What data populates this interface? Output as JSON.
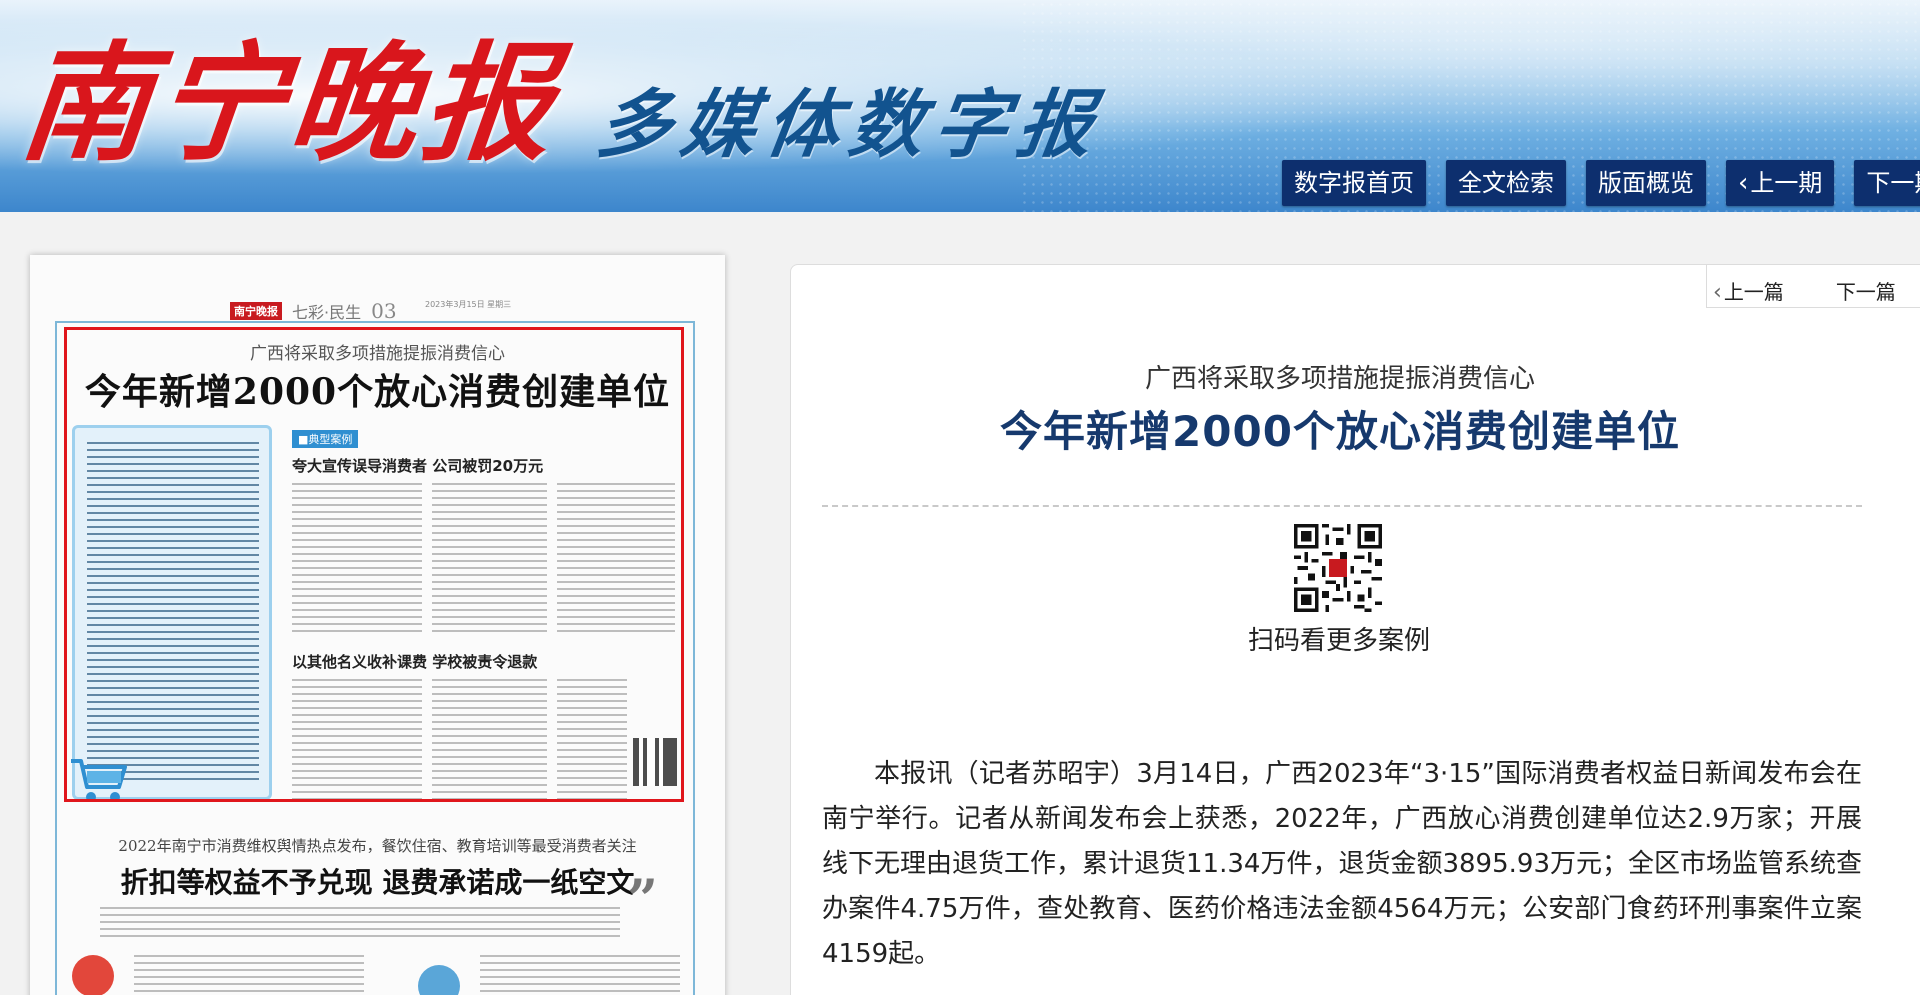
{
  "header": {
    "brand_name": "南宁晚报",
    "brand_sub": "多媒体数字报",
    "nav": [
      {
        "label": "数字报首页"
      },
      {
        "label": "全文检索"
      },
      {
        "label": "版面概览"
      },
      {
        "label": "上一期"
      },
      {
        "label": "下一期"
      }
    ]
  },
  "thumbnail": {
    "mini_logo": "南宁晚报",
    "section_name": "七彩·民生",
    "page_number": "03",
    "meta_line": "2023年3月15日  星期三",
    "headline_kicker": "广西将采取多项措施提振消费信心",
    "headline_title": "今年新增2000个放心消费创建单位",
    "case_tag": "■典型案例",
    "sub_heads": [
      "夸大宣传误导消费者  公司被罚20万元",
      "以其他名义收补课费  学校被责令退款"
    ],
    "second_kicker": "2022年南宁市消费维权舆情热点发布，餐饮住宿、教育培训等最受消费者关注",
    "second_title": "折扣等权益不予兑现  退费承诺成一纸空文"
  },
  "article": {
    "prev_label": "上一篇",
    "next_label": "下一篇",
    "subtitle": "广西将采取多项措施提振消费信心",
    "title": "今年新增2000个放心消费创建单位",
    "qr_caption": "扫码看更多案例",
    "body": "本报讯（记者苏昭宇）3月14日，广西2023年“3·15”国际消费者权益日新闻发布会在南宁举行。记者从新闻发布会上获悉，2022年，广西放心消费创建单位达2.9万家；开展线下无理由退货工作，累计退货11.34万件，退货金额3895.93万元；全区市场监管系统查办案件4.75万件，查处教育、医药价格违法金额4564万元；公安部门食药环刑事案件立案4159起。"
  },
  "colors": {
    "brand_red": "#d9161c",
    "nav_bg": "#0d2f6e",
    "title_blue": "#16396d",
    "highlight_red": "#e0161c"
  }
}
